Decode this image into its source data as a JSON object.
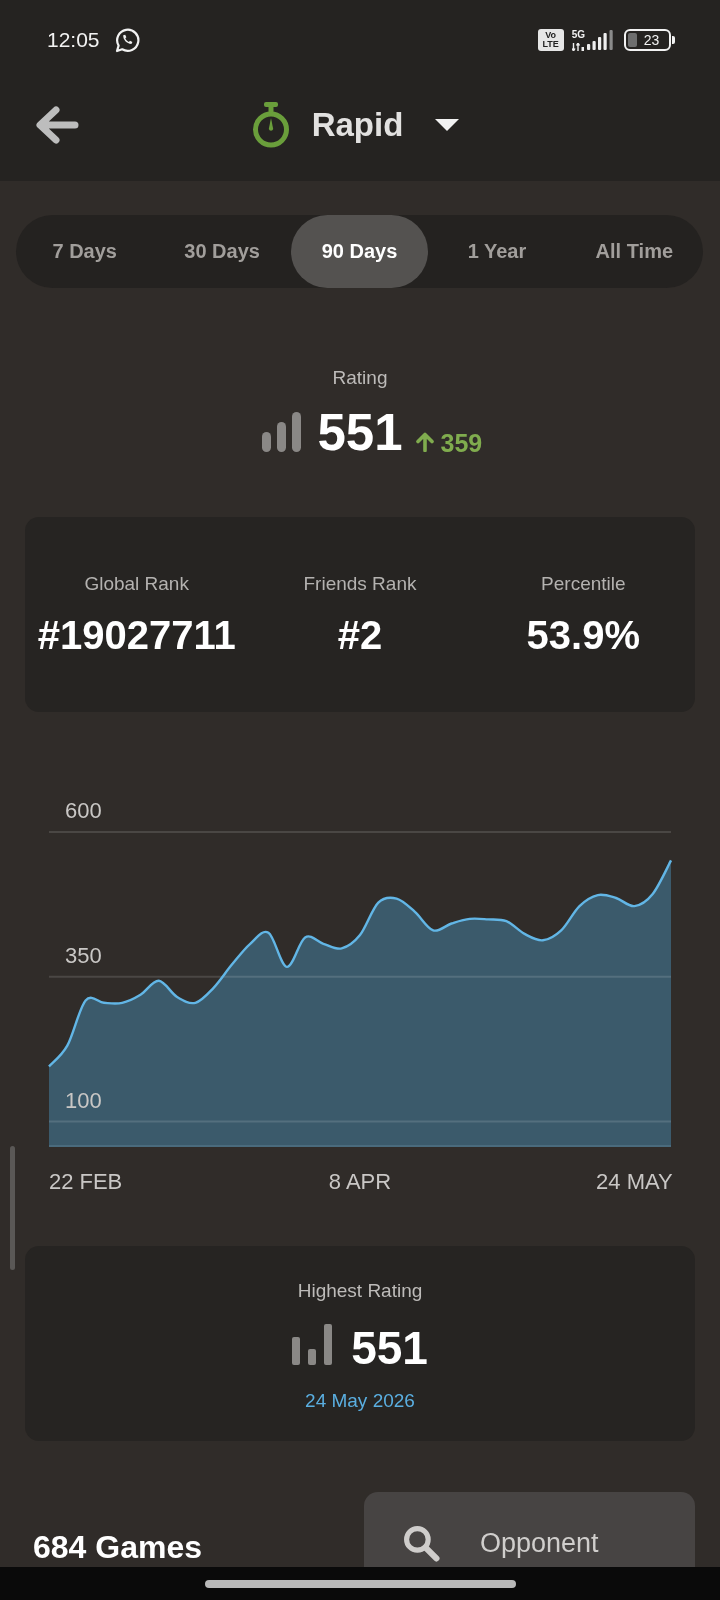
{
  "status_bar": {
    "time": "12:05",
    "volte": "Vo LTE",
    "network": "5G",
    "battery": "23"
  },
  "header": {
    "title": "Rapid"
  },
  "range_tabs": [
    {
      "label": "7 Days",
      "selected": false
    },
    {
      "label": "30 Days",
      "selected": false
    },
    {
      "label": "90 Days",
      "selected": true
    },
    {
      "label": "1 Year",
      "selected": false
    },
    {
      "label": "All Time",
      "selected": false
    }
  ],
  "rating": {
    "label": "Rating",
    "value": "551",
    "change": "359"
  },
  "ranks": [
    {
      "label": "Global Rank",
      "value": "#19027711"
    },
    {
      "label": "Friends Rank",
      "value": "#2"
    },
    {
      "label": "Percentile",
      "value": "53.9%"
    }
  ],
  "rating_chart": {
    "chart_data": {
      "type": "area",
      "categories": [
        null,
        null,
        "22 FEB",
        null,
        null,
        null,
        null,
        null,
        null,
        null,
        null,
        null,
        null,
        null,
        null,
        null,
        null,
        "8 APR",
        null,
        null,
        null,
        null,
        null,
        null,
        null,
        null,
        null,
        null,
        null,
        null,
        null,
        null,
        "24 MAY",
        null,
        null
      ],
      "ylim": [
        56,
        600
      ],
      "yticks": [
        100,
        350,
        600
      ],
      "series": [
        {
          "color": "#62b6e6",
          "values": [
            195,
            231,
            309,
            305,
            305,
            319,
            343,
            315,
            305,
            331,
            371,
            407,
            426,
            367,
            418,
            407,
            399,
            422,
            478,
            485,
            462,
            430,
            442,
            450,
            449,
            446,
            424,
            413,
            430,
            472,
            491,
            486,
            472,
            493,
            551
          ]
        }
      ]
    }
  },
  "highest_rating": {
    "label": "Highest Rating",
    "value": "551",
    "date": "24 May 2026"
  },
  "games": {
    "count": "684 Games"
  },
  "opponent_button": {
    "label": "Opponent"
  }
}
